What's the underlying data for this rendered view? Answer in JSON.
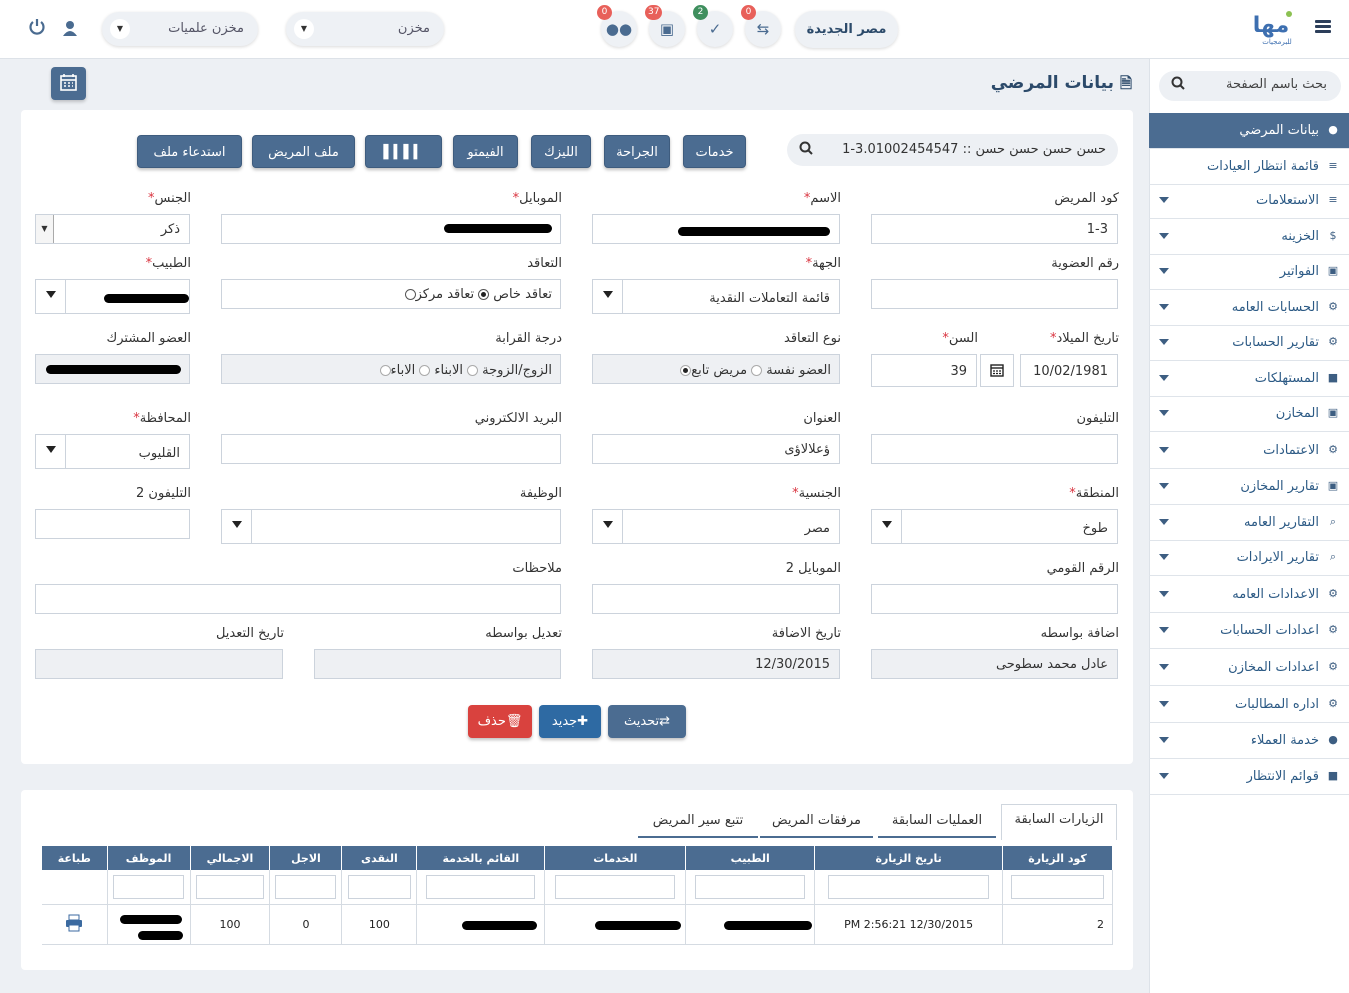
{
  "topbar": {
    "branch": "مصر الجديدة",
    "badges": {
      "exchange": "0",
      "tasks": "2",
      "money": "37",
      "users": "0"
    },
    "store1": "مخزن",
    "store2": "مخزن علميات",
    "logo_text": "مها",
    "logo_subtext": "للبرمجيات"
  },
  "sidebar": {
    "search_placeholder": "بحث باسم الصفحة",
    "items": [
      {
        "label": "بيانات المرضي",
        "icon": "user-icon"
      },
      {
        "label": "قائمة انتظار العيادات",
        "icon": "list-icon"
      },
      {
        "label": "الاستعلامات",
        "icon": "list-icon"
      },
      {
        "label": "الخزينه",
        "icon": "dollar-icon"
      },
      {
        "label": "الفواتير",
        "icon": "money-icon"
      },
      {
        "label": "الحسابات العامه",
        "icon": "cogs-icon"
      },
      {
        "label": "تقارير الحسابات",
        "icon": "cogs-icon"
      },
      {
        "label": "المستهلكات",
        "icon": "box-icon"
      },
      {
        "label": "المخازن",
        "icon": "money-icon"
      },
      {
        "label": "الاعتمادات",
        "icon": "gear-icon"
      },
      {
        "label": "تقارير المخازن",
        "icon": "money-icon"
      },
      {
        "label": "التقارير العامه",
        "icon": "search-icon"
      },
      {
        "label": "تقارير الايرادات",
        "icon": "search-icon"
      },
      {
        "label": "الاعدادات العامه",
        "icon": "gear-icon"
      },
      {
        "label": "اعدادات الحسابات",
        "icon": "cogs-icon"
      },
      {
        "label": "اعدادات المخازن",
        "icon": "gear-icon"
      },
      {
        "label": "اداره المطالبات",
        "icon": "gear-icon"
      },
      {
        "label": "خدمة العملاء",
        "icon": "user-icon"
      },
      {
        "label": "قوائم الانتظار",
        "icon": "box-icon"
      }
    ]
  },
  "page": {
    "title": "بيانات المرضي",
    "patient_search_value": "1-3.حسن حسن حسن حسن :: 01002454547"
  },
  "actions": [
    "خدمات",
    "الجراحة",
    "الليزك",
    "الفيمتو",
    "باركود",
    "ملف المريض",
    "استدعاء ملف"
  ],
  "form": {
    "code_label": "كود المريض",
    "code_value": "1-3",
    "name_label": "الاسم",
    "mobile_label": "الموبايل",
    "gender_label": "الجنس",
    "gender_value": "ذكر",
    "membership_label": "رقم العضوية",
    "party_label": "الجهة",
    "party_value": "قائمة التعاملات النقدية",
    "contract_label": "التعاقد",
    "contract_opt1": "تعاقد خاص",
    "contract_opt2": "تعاقد مركز",
    "doctor_label": "الطبيب",
    "birth_label": "تاريخ الميلاد",
    "birth_value": "10/02/1981",
    "age_label": "السن",
    "age_value": "39",
    "contract_type_label": "نوع التعاقد",
    "ct_opt1": "العضو نفسة",
    "ct_opt2": "مريض تابع",
    "relation_label": "درجة القرابة",
    "rel_opt1": "الزوج/الزوجة",
    "rel_opt2": "الابناء",
    "rel_opt3": "الاباء",
    "subscriber_label": "العضو المشترك",
    "phone_label": "التليفون",
    "address_label": "العنوان",
    "address_value": "ؤعلالاؤى",
    "email_label": "البريد الالكتروني",
    "governorate_label": "المحافظة",
    "governorate_value": "القليوب",
    "region_label": "المنطقة",
    "region_value": "طوخ",
    "nationality_label": "الجنسية",
    "nationality_value": "مصر",
    "job_label": "الوظيفة",
    "phone2_label": "التليفون 2",
    "national_id_label": "الرقم القومي",
    "mobile2_label": "الموبايل 2",
    "notes_label": "ملاحظات",
    "added_by_label": "اضافة بواسطه",
    "added_by_value": "عادل محمد سطوحى",
    "added_date_label": "تاريخ الاضافة",
    "added_date_value": "12/30/2015",
    "edited_by_label": "تعديل بواسطه",
    "edited_date_label": "تاريخ التعديل"
  },
  "buttons": {
    "update": "تحديث",
    "new": "جديد",
    "delete": "حذف"
  },
  "tabs": [
    "الزيارات السابقة",
    "العمليات السابقة",
    "مرفقات المريض",
    "تتبع سير المريض"
  ],
  "grid": {
    "headers": [
      "كود الزيارة",
      "تاريخ الزيارة",
      "الطبيب",
      "الخدمات",
      "القائم بالخدمة",
      "النقدى",
      "الاجل",
      "الاجمالي",
      "الموظف",
      "طباعة"
    ],
    "row": {
      "code": "2",
      "date": "PM 2:56:21 12/30/2015",
      "cash": "100",
      "deferred": "0",
      "total": "100"
    }
  }
}
